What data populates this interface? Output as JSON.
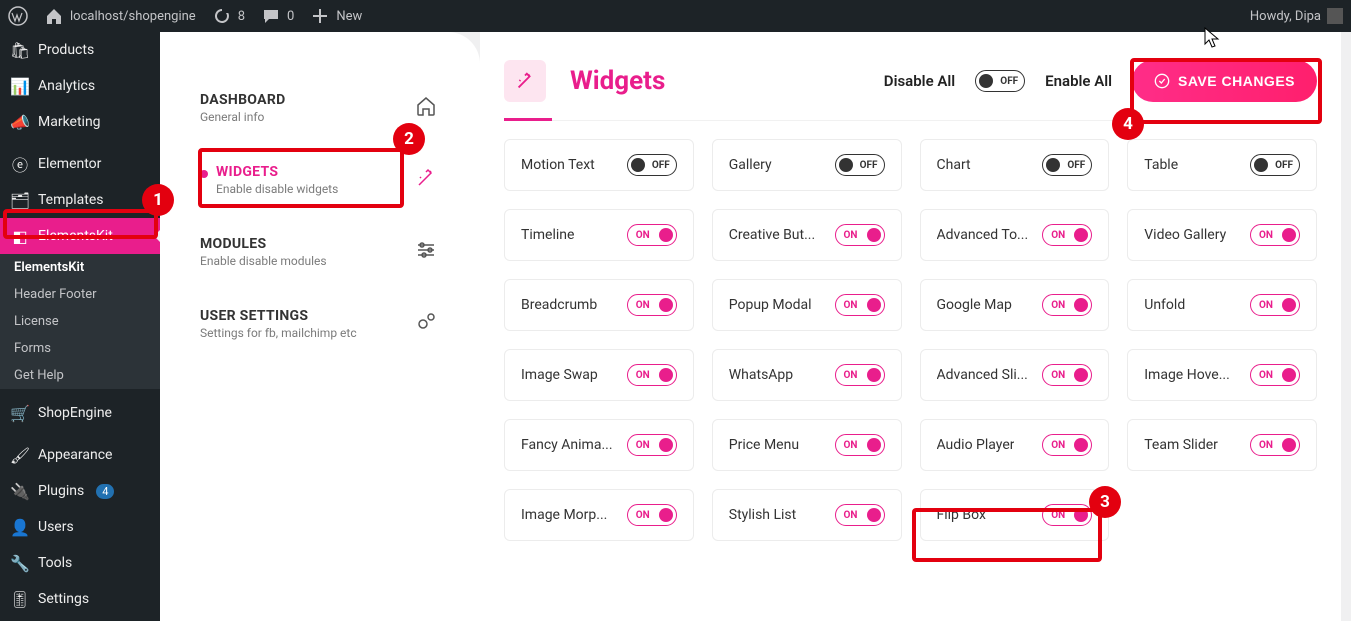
{
  "adminbar": {
    "site_url": "localhost/shopengine",
    "updates": "8",
    "comments": "0",
    "new": "New",
    "howdy": "Howdy, Dipa"
  },
  "sidebar": {
    "items": [
      {
        "label": "Products"
      },
      {
        "label": "Analytics"
      },
      {
        "label": "Marketing"
      },
      {
        "label": "Elementor"
      },
      {
        "label": "Templates"
      },
      {
        "label": "ElementsKit"
      },
      {
        "label": "ShopEngine"
      },
      {
        "label": "Appearance"
      },
      {
        "label": "Plugins"
      },
      {
        "label": "Users"
      },
      {
        "label": "Tools"
      },
      {
        "label": "Settings"
      }
    ],
    "plugins_badge": "4",
    "submenu": [
      {
        "label": "ElementsKit"
      },
      {
        "label": "Header Footer"
      },
      {
        "label": "License"
      },
      {
        "label": "Forms"
      },
      {
        "label": "Get Help"
      }
    ]
  },
  "settings": {
    "dashboard": {
      "title": "DASHBOARD",
      "sub": "General info"
    },
    "widgets": {
      "title": "WIDGETS",
      "sub": "Enable disable widgets"
    },
    "modules": {
      "title": "MODULES",
      "sub": "Enable disable modules"
    },
    "usersettings": {
      "title": "USER SETTINGS",
      "sub": "Settings for fb, mailchimp etc"
    }
  },
  "panel": {
    "title": "Widgets",
    "disable_all": "Disable All",
    "enable_all": "Enable All",
    "save": "SAVE CHANGES",
    "off_text": "OFF",
    "on_text": "ON"
  },
  "widgets": [
    {
      "name": "Motion Text",
      "on": false
    },
    {
      "name": "Gallery",
      "on": false
    },
    {
      "name": "Chart",
      "on": false
    },
    {
      "name": "Table",
      "on": false
    },
    {
      "name": "Timeline",
      "on": true
    },
    {
      "name": "Creative But...",
      "on": true
    },
    {
      "name": "Advanced To...",
      "on": true
    },
    {
      "name": "Video Gallery",
      "on": true
    },
    {
      "name": "Breadcrumb",
      "on": true
    },
    {
      "name": "Popup Modal",
      "on": true
    },
    {
      "name": "Google Map",
      "on": true
    },
    {
      "name": "Unfold",
      "on": true
    },
    {
      "name": "Image Swap",
      "on": true
    },
    {
      "name": "WhatsApp",
      "on": true
    },
    {
      "name": "Advanced Sli...",
      "on": true
    },
    {
      "name": "Image Hove...",
      "on": true
    },
    {
      "name": "Fancy Anima...",
      "on": true
    },
    {
      "name": "Price Menu",
      "on": true
    },
    {
      "name": "Audio Player",
      "on": true
    },
    {
      "name": "Team Slider",
      "on": true
    },
    {
      "name": "Image Morp...",
      "on": true
    },
    {
      "name": "Stylish List",
      "on": true
    },
    {
      "name": "Flip Box",
      "on": true
    }
  ],
  "callouts": {
    "1": "1",
    "2": "2",
    "3": "3",
    "4": "4"
  }
}
